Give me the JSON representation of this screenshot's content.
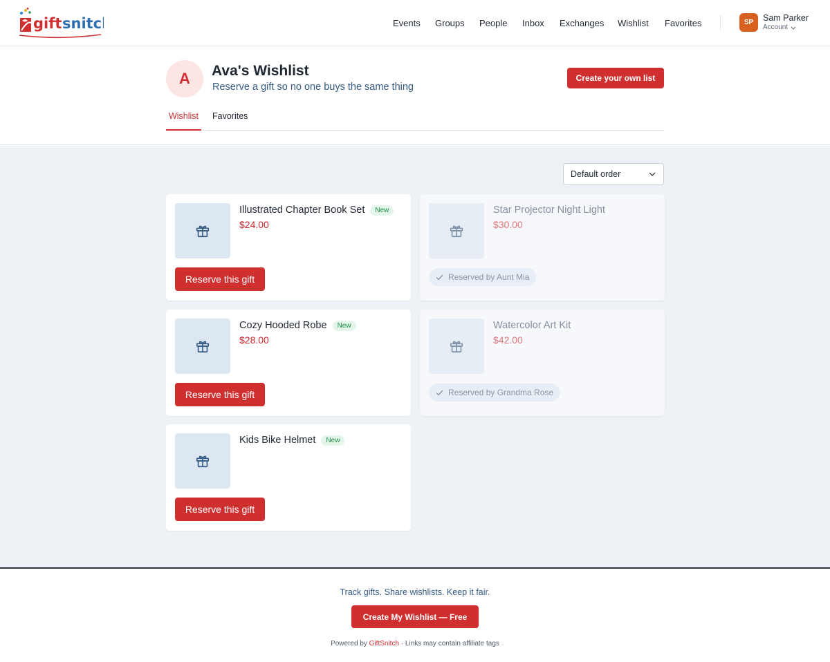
{
  "header": {
    "logo_text": "giftsnitch",
    "nav": [
      "Events",
      "Groups",
      "People",
      "Inbox",
      "Exchanges",
      "Wishlist",
      "Favorites"
    ],
    "user": {
      "initials": "SP",
      "name": "Sam Parker",
      "sub": "Account"
    }
  },
  "profile": {
    "avatar_letter": "A",
    "title": "Ava's Wishlist",
    "subtitle": "Reserve a gift so no one buys the same thing",
    "create_button": "Create your own list",
    "tabs": [
      {
        "label": "Wishlist",
        "active": true
      },
      {
        "label": "Favorites",
        "active": false
      }
    ]
  },
  "main": {
    "sort_label": "Default order",
    "items": [
      {
        "name": "Illustrated Chapter Book Set",
        "badge": "New",
        "price": "$24.00",
        "action": "Reserve this gift",
        "reserved": false
      },
      {
        "name": "Star Projector Night Light",
        "badge": "",
        "price": "$30.00",
        "action": "Reserved by Aunt Mia",
        "reserved": true
      },
      {
        "name": "Cozy Hooded Robe",
        "badge": "New",
        "price": "$28.00",
        "action": "Reserve this gift",
        "reserved": false
      },
      {
        "name": "Watercolor Art Kit",
        "badge": "",
        "price": "$42.00",
        "action": "Reserved by Grandma Rose",
        "reserved": true
      },
      {
        "name": "Kids Bike Helmet",
        "badge": "New",
        "price": "",
        "action": "Reserve this gift",
        "reserved": false
      }
    ]
  },
  "footer": {
    "tagline": "Track gifts. Share wishlists. Keep it fair.",
    "cta": "Create My Wishlist — Free",
    "powered_prefix": "Powered by ",
    "powered_brand": "GiftSnitch",
    "powered_suffix": " · Links may contain affiliate tags"
  },
  "colors": {
    "accent": "#d02f30",
    "page_bg": "#eef2f7",
    "new_badge_bg": "#e3f6e9",
    "new_badge_text": "#1f8a44",
    "user_avatar": "#d9611f"
  }
}
